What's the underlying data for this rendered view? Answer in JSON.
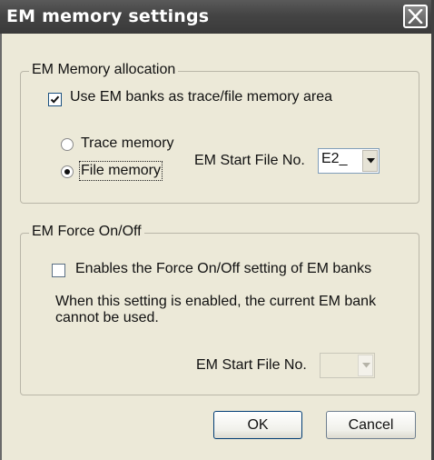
{
  "window": {
    "title": "EM memory settings",
    "close_icon": "close-icon"
  },
  "allocation": {
    "legend": "EM Memory allocation",
    "use_em_banks_label": "Use EM banks as trace/file memory area",
    "use_em_banks_checked": true,
    "trace_memory_label": "Trace memory",
    "trace_memory_selected": false,
    "file_memory_label": "File memory",
    "file_memory_selected": true,
    "start_file_label": "EM Start File No.",
    "start_file_value": "E2_"
  },
  "force": {
    "legend": "EM Force On/Off",
    "enable_label": "Enables the Force On/Off setting of EM banks",
    "enable_checked": false,
    "note": "When this setting is enabled, the current EM bank cannot be used.",
    "start_file_label": "EM Start File No.",
    "start_file_value": ""
  },
  "buttons": {
    "ok": "OK",
    "cancel": "Cancel"
  }
}
